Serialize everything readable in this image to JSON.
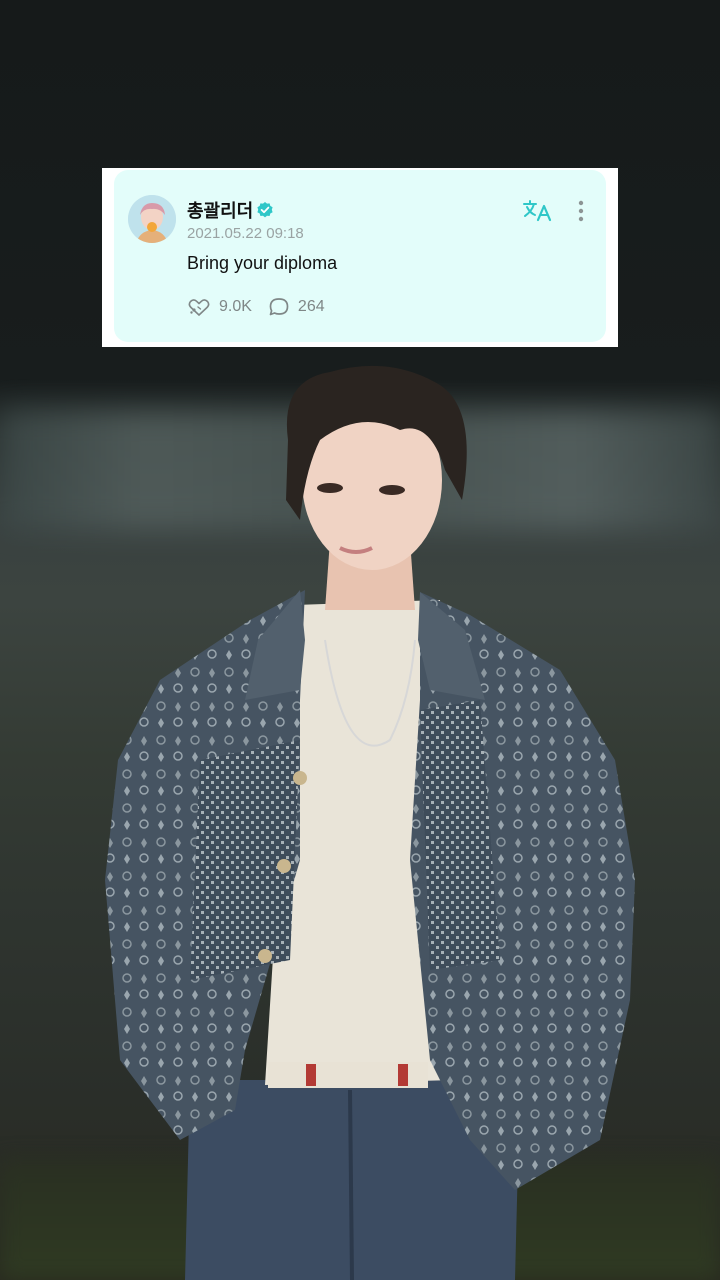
{
  "post": {
    "author": "총괄리더",
    "timestamp": "2021.05.22 09:18",
    "text": "Bring your diploma",
    "likes": "9.0K",
    "comments": "264"
  },
  "icons": {
    "verified": "verified-badge-icon",
    "translate": "translate-icon",
    "more": "more-vertical-icon",
    "like": "heart-paw-icon",
    "comment": "comment-bubble-icon"
  },
  "colors": {
    "card_background": "#e3fdfa",
    "accent": "#2fc7c8",
    "text_primary": "#111111",
    "text_secondary": "#9aa3a3"
  }
}
